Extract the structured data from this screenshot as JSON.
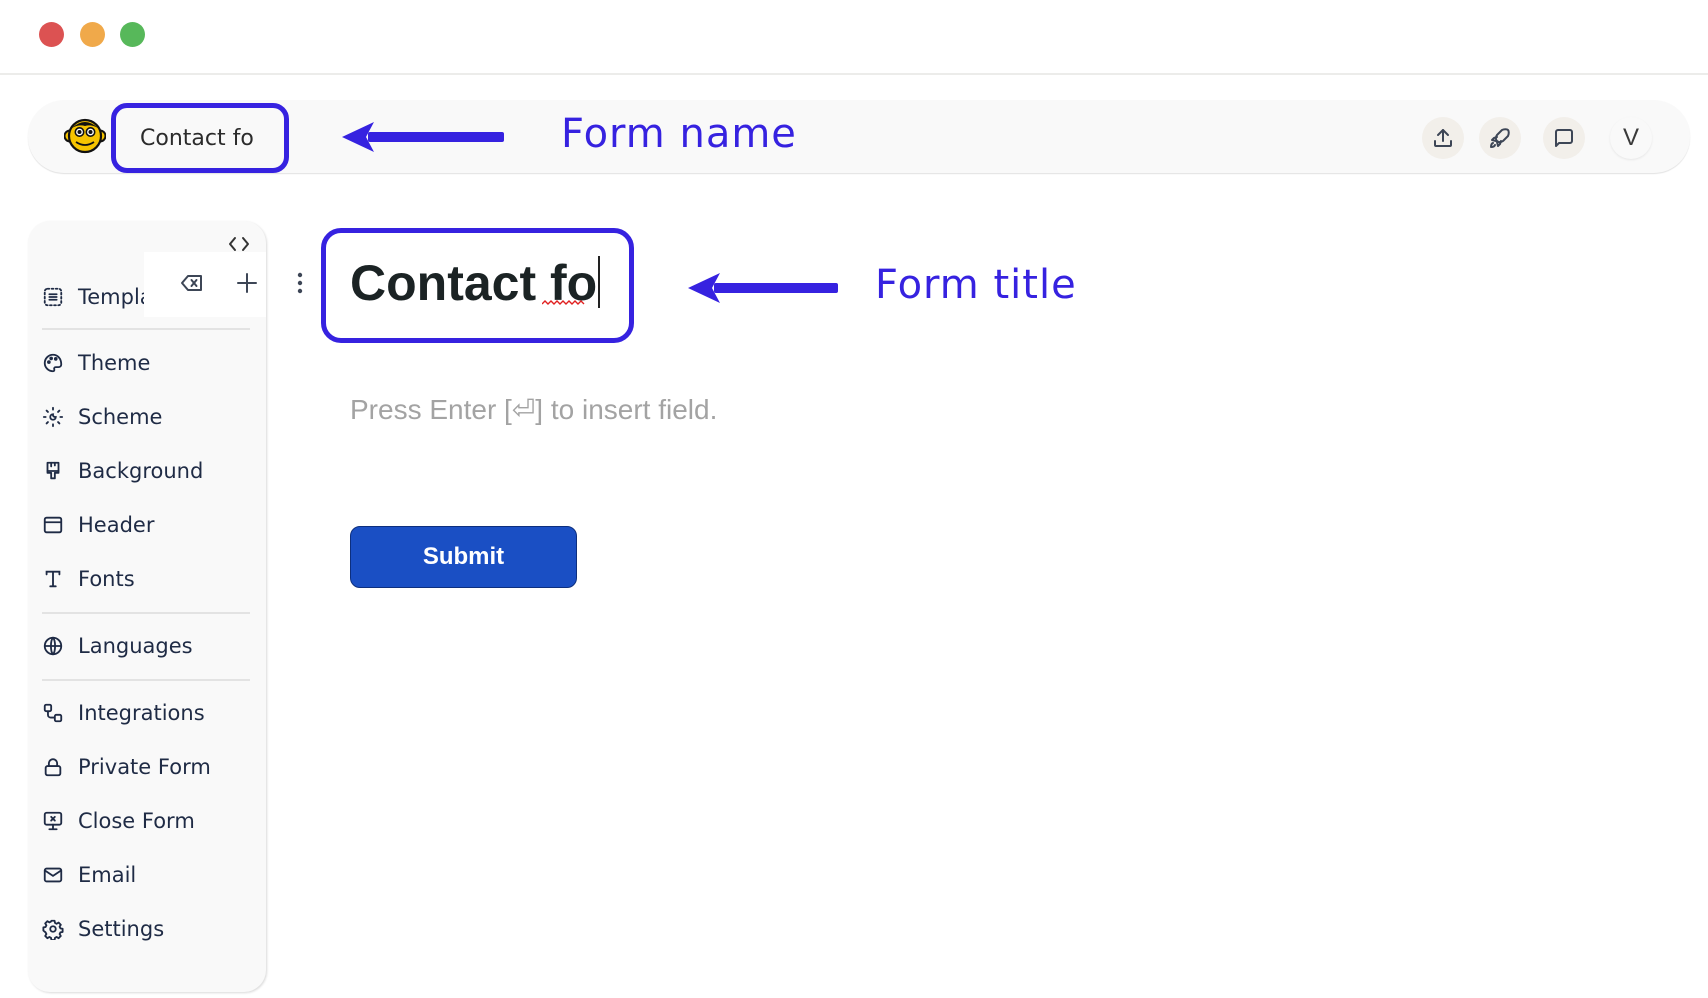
{
  "window": {
    "controls": [
      "close",
      "minimize",
      "maximize"
    ]
  },
  "topbar": {
    "logo_icon": "monkey-face-icon",
    "form_name": "Contact fo",
    "actions": [
      {
        "name": "share",
        "icon": "upload-icon"
      },
      {
        "name": "publish",
        "icon": "rocket-icon"
      },
      {
        "name": "feedback",
        "icon": "chat-bubble-icon"
      },
      {
        "name": "account",
        "label": "V"
      }
    ]
  },
  "annotations": {
    "form_name_label": "Form name",
    "form_title_label": "Form title",
    "color": "#3622e0"
  },
  "sidebar": {
    "collapse_icon": "code-brackets-icon",
    "items": [
      {
        "label": "Templates",
        "visible_label": "Templa",
        "icon": "template-icon"
      },
      {
        "label": "Theme",
        "icon": "palette-icon"
      },
      {
        "label": "Scheme",
        "icon": "sun-moon-icon"
      },
      {
        "label": "Background",
        "icon": "paint-brush-icon"
      },
      {
        "label": "Header",
        "icon": "header-layout-icon"
      },
      {
        "label": "Fonts",
        "icon": "type-icon"
      },
      {
        "label": "Languages",
        "icon": "globe-icon"
      },
      {
        "label": "Integrations",
        "icon": "integrations-icon"
      },
      {
        "label": "Private Form",
        "icon": "lock-icon"
      },
      {
        "label": "Close Form",
        "icon": "monitor-x-icon"
      },
      {
        "label": "Email",
        "icon": "mail-icon"
      },
      {
        "label": "Settings",
        "icon": "gear-icon"
      }
    ]
  },
  "block_toolbar": {
    "delete_icon": "backspace-icon",
    "add_icon": "plus-icon",
    "more_icon": "vertical-dots-icon"
  },
  "editor": {
    "form_title": "Contact fo",
    "hint": "Press Enter [⏎] to insert field.",
    "submit_label": "Submit",
    "submit_color": "#1a4fc4"
  }
}
